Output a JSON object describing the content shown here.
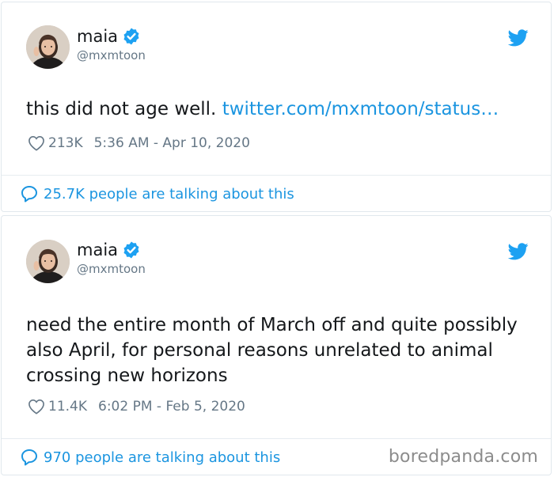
{
  "colors": {
    "link": "#1b95e0",
    "text": "#14171a",
    "muted": "#657786",
    "border": "#e1e8ed",
    "verified": "#1da1f2",
    "twitter_bird": "#1da1f2"
  },
  "tweets": [
    {
      "display_name": "maia",
      "handle": "@mxmtoon",
      "text": "this did not age well. ",
      "link": "twitter.com/mxmtoon/status…",
      "likes": "213K",
      "timestamp": "5:36 AM - Apr 10, 2020",
      "talking": "25.7K people are talking about this",
      "icons": {
        "verified": "verified-badge-icon",
        "bird": "twitter-bird-icon",
        "like": "heart-icon",
        "reply": "speech-bubble-icon"
      }
    },
    {
      "display_name": "maia",
      "handle": "@mxmtoon",
      "text": "need the entire month of March off and quite possibly also April, for personal reasons unrelated to animal crossing new horizons",
      "likes": "11.4K",
      "timestamp": "6:02 PM - Feb 5, 2020",
      "talking": "970 people are talking about this",
      "watermark": "boredpanda.com",
      "icons": {
        "verified": "verified-badge-icon",
        "bird": "twitter-bird-icon",
        "like": "heart-icon",
        "reply": "speech-bubble-icon"
      }
    }
  ]
}
